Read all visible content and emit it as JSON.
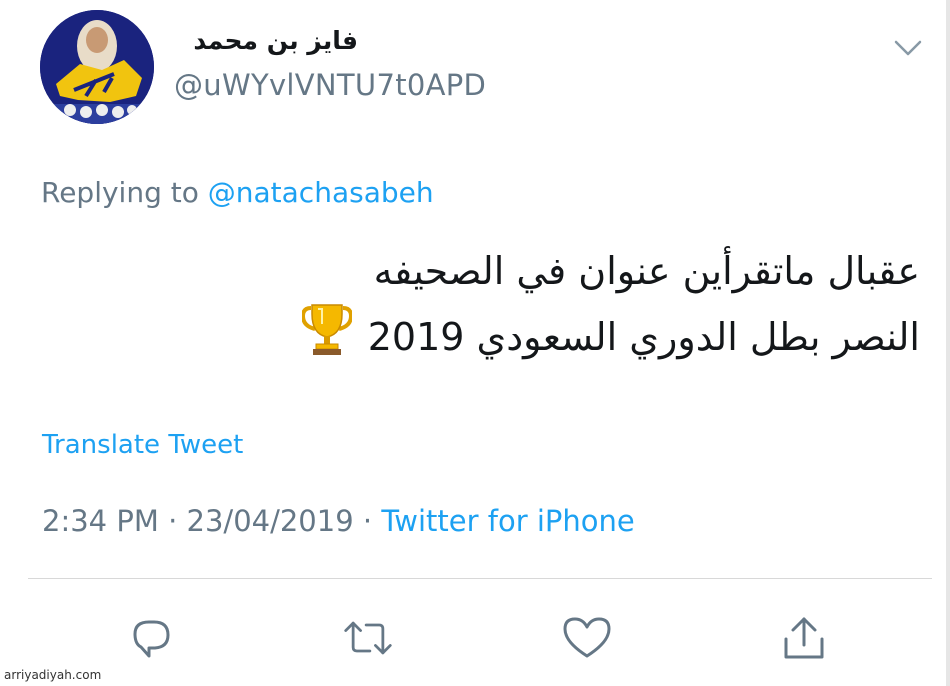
{
  "tweet": {
    "author": {
      "display_name": "فايز بن محمد",
      "handle": "@uWYvlVNTU7t0APD"
    },
    "replying_to": {
      "prefix": "Replying to",
      "mention": "@natachasabeh"
    },
    "text_lines": [
      "عقبال ماتقرأين عنوان في الصحيفه",
      "النصر بطل الدوري السعودي 2019"
    ],
    "emoji": "trophy-icon",
    "translate_label": "Translate Tweet",
    "time": "2:34 PM",
    "separator": "·",
    "date": "23/04/2019",
    "source": "Twitter for iPhone"
  },
  "actions": [
    {
      "name": "reply",
      "icon": "comment-icon"
    },
    {
      "name": "retweet",
      "icon": "retweet-icon"
    },
    {
      "name": "like",
      "icon": "heart-icon"
    },
    {
      "name": "share",
      "icon": "share-icon"
    }
  ],
  "watermark": "arriyadiyah.com",
  "colors": {
    "link": "#1da1f2",
    "secondary": "#657786",
    "primary": "#14171a"
  }
}
